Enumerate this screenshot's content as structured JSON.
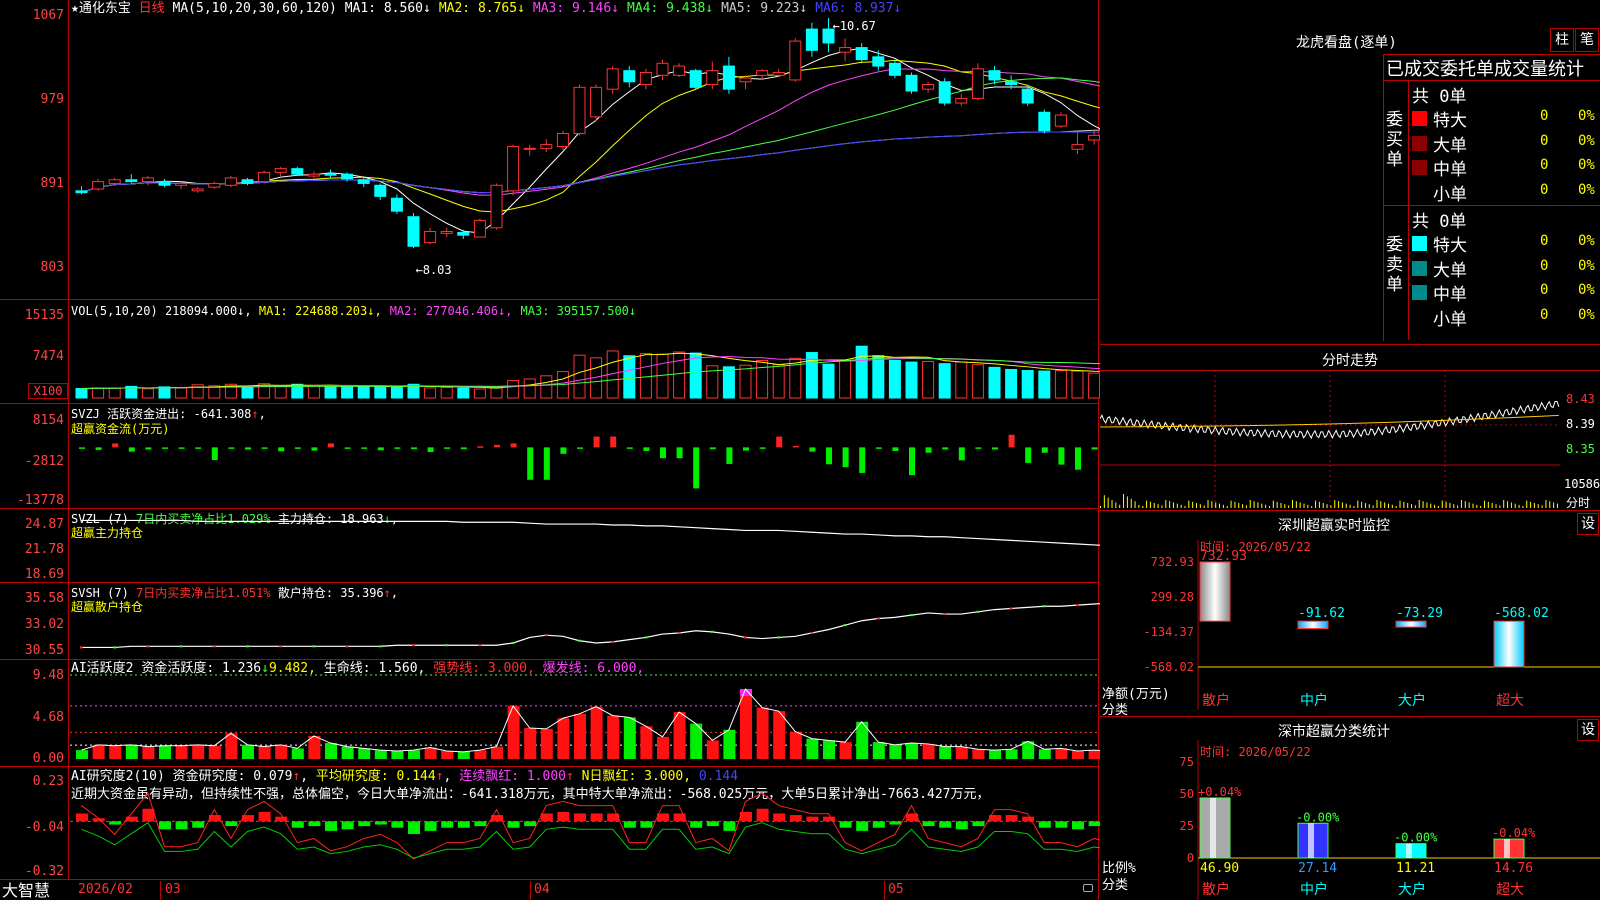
{
  "stock": {
    "star": "★",
    "name": "通化东宝",
    "period": "日线"
  },
  "ma_header": {
    "label": "MA(5,10,20,30,60,120)",
    "items": [
      {
        "text": "MA1: 8.560↓",
        "color": "#ffffff"
      },
      {
        "text": "MA2: 8.765↓",
        "color": "#ffff00"
      },
      {
        "text": "MA3: 9.146↓",
        "color": "#ff44ff"
      },
      {
        "text": "MA4: 9.438↓",
        "color": "#44ff44"
      },
      {
        "text": "MA5: 9.223↓",
        "color": "#cccccc"
      },
      {
        "text": "MA6: 8.937↓",
        "color": "#4444ff"
      }
    ],
    "high_mark": "10.67",
    "low_mark": "8.03"
  },
  "vol_header": {
    "label": "VOL(5,10,20)",
    "value": "218094.000↓,",
    "items": [
      {
        "text": "MA1: 224688.203↓,",
        "color": "#ffff00"
      },
      {
        "text": "MA2: 277046.406↓,",
        "color": "#ff44ff"
      },
      {
        "text": "MA3: 395157.500↓",
        "color": "#44ff44"
      }
    ]
  },
  "svzj_header": {
    "label": "SVZJ",
    "title": "活跃资金进出: -641.308",
    "arrow": "↑",
    "tail": ",",
    "sub": "超赢资金流(万元)"
  },
  "svzl_header": {
    "label": "SVZL (7)",
    "pct": "7日内买卖净占比1.029%",
    "title": "主力持仓: 18.963",
    "arrow": "↓",
    "tail": ",",
    "sub": "超赢主力持仓"
  },
  "svsh_header": {
    "label": "SVSH (7)",
    "pct": "7日内买卖净占比1.051%",
    "title": "散户持仓: 35.396",
    "arrow": "↑",
    "tail": ",",
    "sub": "超赢散户持仓"
  },
  "ai1_header": {
    "label": "AI活跃度2",
    "t1": "资金活跃度: 1.236",
    "a1": "↓",
    "t2": "9.482,",
    "t3": "生命线: 1.560,",
    "t4": "强势线: 3.000,",
    "t5": "爆发线: 6.000,"
  },
  "ai2_header": {
    "label": "AI研究度2(10)",
    "t1": "资金研究度: 0.079",
    "a1": "↑",
    "t2": "平均研究度: 0.144",
    "a2": "↑",
    "t3": "连续飘红: 1.000",
    "a3": "↑",
    "t4": "N日飘红: 3.000,",
    "t5": "0.144",
    "comment": "近期大资金虽有异动，但持续性不强，总体偏空，今日大单净流出：-641.318万元，其中特大单净流出：-568.025万元，大单5日累计净出-7663.427万元，"
  },
  "axes": {
    "price": [
      "1067",
      "979",
      "891",
      "803"
    ],
    "vol": [
      "15135",
      "7474",
      "X100"
    ],
    "svzj": [
      "8154",
      "-2812",
      "-13778"
    ],
    "svzl": [
      "24.87",
      "21.78",
      "18.69"
    ],
    "svsh": [
      "35.58",
      "33.02",
      "30.55"
    ],
    "ai1": [
      "9.48",
      "4.68",
      "0.00"
    ],
    "ai2": [
      "0.23",
      "-0.04",
      "-0.32"
    ]
  },
  "bottom_bar": {
    "logo": "大智慧",
    "dates": [
      "2026/02",
      "03",
      "04",
      "05"
    ]
  },
  "right": {
    "dragon_title": "龙虎看盘(逐单)",
    "btn_zhu": "柱",
    "btn_bi": "笔",
    "stat_title": "已成交委托单成交量统计",
    "buy_label": "委买单",
    "sell_label": "委卖单",
    "buy_total": "共 0单",
    "sell_total": "共 0单",
    "rows": [
      {
        "name": "特大",
        "v": "0",
        "p": "0%"
      },
      {
        "name": "大单",
        "v": "0",
        "p": "0%"
      },
      {
        "name": "中单",
        "v": "0",
        "p": "0%"
      },
      {
        "name": "小单",
        "v": "0",
        "p": "0%"
      }
    ],
    "fenshi_title": "分时走势",
    "fenshi_axis": [
      "8.43",
      "8.39",
      "8.35"
    ],
    "fenshi_vol": "10586",
    "fenshi_vol_label": "分时",
    "monitor_title": "深圳超赢实时监控",
    "monitor_btn": "设",
    "monitor_time": "时间: 2026/05/22",
    "monitor_axis": [
      "732.93",
      "299.28",
      "-134.37",
      "-568.02"
    ],
    "monitor_unit": "净额(万元)",
    "monitor_cat_label": "分类",
    "monitor_values": [
      "732.93",
      "-91.62",
      "-73.29",
      "-568.02"
    ],
    "categories": [
      "散户",
      "中户",
      "大户",
      "超大"
    ],
    "class_title": "深市超赢分类统计",
    "class_btn": "设",
    "class_time": "时间: 2026/05/22",
    "class_axis": [
      "75",
      "50",
      "25",
      "0"
    ],
    "class_unit": "比例%",
    "class_cat_label": "分类",
    "class_pct": [
      "+0.04%",
      "-0.00%",
      "-0.00%",
      "-0.04%"
    ],
    "class_values": [
      "46.90",
      "27.14",
      "11.21",
      "14.76"
    ]
  },
  "chart_data": [
    {
      "type": "candlestick",
      "title": "通化东宝 日线",
      "ylim": [
        8.03,
        10.67
      ],
      "ohlc": [
        [
          8.8,
          8.85,
          8.76,
          8.78
        ],
        [
          8.82,
          8.93,
          8.8,
          8.9
        ],
        [
          8.88,
          8.94,
          8.86,
          8.92
        ],
        [
          8.92,
          8.98,
          8.88,
          8.9
        ],
        [
          8.9,
          8.96,
          8.86,
          8.94
        ],
        [
          8.9,
          8.93,
          8.84,
          8.86
        ],
        [
          8.86,
          8.9,
          8.82,
          8.88
        ],
        [
          8.8,
          8.84,
          8.78,
          8.82
        ],
        [
          8.84,
          8.9,
          8.82,
          8.88
        ],
        [
          8.86,
          8.96,
          8.84,
          8.94
        ],
        [
          8.92,
          8.94,
          8.86,
          8.88
        ],
        [
          8.9,
          9.02,
          8.88,
          9.0
        ],
        [
          9.0,
          9.06,
          8.96,
          9.04
        ],
        [
          9.04,
          9.06,
          8.96,
          8.98
        ],
        [
          8.96,
          9.01,
          8.93,
          8.98
        ],
        [
          8.98,
          9.03,
          8.94,
          8.97
        ],
        [
          8.98,
          9.0,
          8.9,
          8.93
        ],
        [
          8.92,
          8.96,
          8.84,
          8.88
        ],
        [
          8.86,
          8.88,
          8.7,
          8.74
        ],
        [
          8.72,
          8.76,
          8.55,
          8.58
        ],
        [
          8.52,
          8.56,
          8.18,
          8.2
        ],
        [
          8.24,
          8.4,
          8.22,
          8.36
        ],
        [
          8.34,
          8.4,
          8.3,
          8.36
        ],
        [
          8.35,
          8.38,
          8.28,
          8.32
        ],
        [
          8.3,
          8.5,
          8.3,
          8.48
        ],
        [
          8.4,
          8.88,
          8.38,
          8.86
        ],
        [
          8.8,
          9.3,
          8.75,
          9.28
        ],
        [
          9.25,
          9.3,
          9.18,
          9.26
        ],
        [
          9.26,
          9.36,
          9.22,
          9.3
        ],
        [
          9.28,
          9.45,
          9.24,
          9.42
        ],
        [
          9.42,
          9.95,
          9.4,
          9.92
        ],
        [
          9.6,
          9.95,
          9.55,
          9.92
        ],
        [
          9.9,
          10.15,
          9.85,
          10.12
        ],
        [
          10.1,
          10.15,
          9.92,
          9.98
        ],
        [
          9.95,
          10.12,
          9.9,
          10.08
        ],
        [
          10.05,
          10.22,
          10.0,
          10.18
        ],
        [
          10.05,
          10.18,
          10.03,
          10.15
        ],
        [
          10.1,
          10.12,
          9.9,
          9.92
        ],
        [
          9.95,
          10.2,
          9.9,
          10.1
        ],
        [
          10.15,
          10.25,
          9.85,
          9.9
        ],
        [
          9.98,
          10.05,
          9.9,
          10.02
        ],
        [
          10.05,
          10.12,
          10.0,
          10.1
        ],
        [
          10.05,
          10.12,
          10.03,
          10.08
        ],
        [
          10.0,
          10.45,
          9.98,
          10.42
        ],
        [
          10.55,
          10.62,
          10.25,
          10.32
        ],
        [
          10.55,
          10.67,
          10.3,
          10.4
        ],
        [
          10.3,
          10.45,
          10.2,
          10.35
        ],
        [
          10.35,
          10.4,
          10.18,
          10.22
        ],
        [
          10.25,
          10.32,
          10.1,
          10.15
        ],
        [
          10.18,
          10.22,
          10.02,
          10.05
        ],
        [
          10.05,
          10.08,
          9.85,
          9.88
        ],
        [
          9.9,
          9.98,
          9.86,
          9.95
        ],
        [
          9.98,
          10.02,
          9.72,
          9.75
        ],
        [
          9.75,
          9.85,
          9.72,
          9.8
        ],
        [
          9.8,
          10.18,
          9.78,
          10.12
        ],
        [
          10.1,
          10.15,
          9.95,
          10.0
        ],
        [
          9.98,
          10.05,
          9.9,
          9.95
        ],
        [
          9.9,
          9.95,
          9.72,
          9.75
        ],
        [
          9.65,
          9.68,
          9.42,
          9.45
        ],
        [
          9.5,
          9.65,
          9.48,
          9.62
        ],
        [
          9.25,
          9.45,
          9.2,
          9.3
        ],
        [
          9.35,
          9.45,
          9.3,
          9.4
        ],
        [
          9.32,
          9.38,
          9.25,
          9.3
        ],
        [
          9.28,
          9.32,
          9.14,
          9.18
        ],
        [
          9.15,
          9.22,
          9.1,
          9.2
        ],
        [
          9.1,
          9.22,
          9.05,
          9.12
        ],
        [
          9.05,
          9.12,
          8.98,
          9.02
        ],
        [
          9.0,
          9.05,
          8.98,
          9.02
        ],
        [
          8.98,
          9.02,
          8.85,
          8.88
        ],
        [
          8.86,
          8.88,
          8.76,
          8.78
        ],
        [
          8.78,
          8.8,
          8.66,
          8.68
        ],
        [
          8.65,
          8.72,
          8.62,
          8.7
        ],
        [
          8.68,
          8.72,
          8.55,
          8.58
        ],
        [
          8.56,
          8.58,
          8.48,
          8.52
        ],
        [
          8.52,
          8.56,
          8.36,
          8.38
        ],
        [
          8.4,
          8.45,
          8.38,
          8.42
        ]
      ]
    },
    {
      "type": "bar",
      "title": "VOL(5,10,20)",
      "ylim": [
        0,
        15135
      ],
      "values": [
        1800,
        1900,
        1850,
        2200,
        1750,
        2100,
        1900,
        2500,
        2300,
        2600,
        2100,
        2700,
        2200,
        2600,
        2400,
        2300,
        2200,
        2100,
        2300,
        2000,
        2600,
        1900,
        2000,
        1850,
        1700,
        1900,
        3300,
        3600,
        4200,
        5000,
        8100,
        7600,
        8900,
        8000,
        8400,
        8300,
        8700,
        8500,
        6100,
        5900,
        6200,
        7100,
        6300,
        7500,
        8600,
        6400,
        7100,
        9800,
        8000,
        7100,
        6800,
        6900,
        6500,
        6800,
        6300,
        5800,
        5400,
        5200,
        5100,
        5200,
        5100,
        4700,
        4900,
        3700,
        3500,
        3400,
        3500,
        3000,
        3400,
        3000,
        3300,
        3000,
        2600,
        2500,
        2700,
        2400
      ]
    },
    {
      "type": "bar",
      "title": "超赢资金流(万元)",
      "ylim": [
        -13778,
        8154
      ],
      "values": [
        -400,
        -700,
        1100,
        -1200,
        -600,
        -300,
        -300,
        -300,
        -3500,
        -200,
        -600,
        -200,
        -1100,
        -300,
        -900,
        1100,
        -200,
        -200,
        -800,
        -400,
        -500,
        -1300,
        -300,
        -500,
        300,
        700,
        1100,
        -9000,
        -9000,
        -1800,
        -400,
        3000,
        3000,
        -400,
        -1000,
        -3000,
        -3000,
        -11400,
        -500,
        -4600,
        -900,
        -200,
        3000,
        400,
        -1200,
        -4700,
        -5500,
        -7100,
        -300,
        -1000,
        -7700,
        -1500,
        -600,
        -3600,
        -300,
        -600,
        3500,
        -4300,
        -1500,
        -4800,
        -6200,
        -600,
        -300,
        -600,
        -700,
        -700,
        -500,
        -200,
        -1000,
        -700,
        -1200,
        -200,
        -600,
        -3600,
        -1000,
        -700
      ]
    },
    {
      "type": "line",
      "title": "超赢主力持仓",
      "ylim": [
        18.69,
        24.87
      ],
      "values": [
        24.6,
        24.6,
        24.6,
        24.6,
        24.6,
        24.6,
        24.6,
        24.5,
        24.5,
        24.5,
        24.5,
        24.5,
        24.5,
        24.5,
        24.5,
        24.5,
        24.5,
        24.5,
        24.5,
        24.5,
        24.5,
        24.5,
        24.5,
        24.4,
        24.4,
        24.4,
        24.4,
        24.3,
        24.2,
        24.2,
        24.2,
        24.2,
        24.1,
        24.1,
        24.0,
        24.0,
        23.9,
        23.8,
        23.7,
        23.6,
        23.5,
        23.5,
        23.5,
        23.4,
        23.3,
        23.2,
        23.1,
        23.1,
        23.0,
        22.9,
        22.9,
        22.8,
        22.8,
        22.7,
        22.6,
        22.5,
        22.4,
        22.3,
        22.2,
        22.1,
        22.0,
        21.9,
        21.8,
        21.7,
        21.6,
        21.5,
        21.3,
        21.2,
        21.0,
        20.8,
        20.6,
        20.4,
        20.2,
        19.9,
        19.4,
        19.1
      ]
    },
    {
      "type": "line",
      "title": "超赢散户持仓",
      "ylim": [
        30.55,
        35.58
      ],
      "values": [
        30.6,
        30.6,
        30.6,
        30.7,
        30.7,
        30.7,
        30.7,
        30.7,
        30.7,
        30.7,
        30.7,
        30.7,
        30.7,
        30.7,
        30.7,
        30.7,
        30.7,
        30.7,
        30.7,
        30.8,
        30.8,
        30.8,
        30.8,
        30.8,
        30.8,
        30.8,
        31.0,
        31.5,
        31.7,
        31.6,
        31.2,
        31.0,
        31.1,
        31.3,
        31.5,
        31.8,
        31.9,
        32.1,
        32.0,
        31.8,
        31.5,
        31.4,
        31.5,
        31.6,
        31.9,
        32.2,
        32.6,
        33.0,
        33.2,
        33.3,
        33.5,
        33.7,
        33.6,
        33.6,
        33.8,
        34.0,
        34.1,
        34.2,
        34.3,
        34.3,
        34.4,
        34.5,
        34.6,
        34.7,
        34.8,
        34.9,
        35.0,
        35.1,
        35.1,
        35.2,
        35.2,
        35.2,
        35.3,
        35.3,
        35.4,
        35.4
      ]
    },
    {
      "type": "bar",
      "title": "AI活跃度2",
      "ylim": [
        0,
        9.48
      ],
      "values": [
        1.0,
        1.6,
        1.5,
        1.6,
        1.4,
        1.5,
        1.5,
        1.6,
        1.5,
        2.9,
        1.6,
        1.4,
        1.6,
        1.2,
        2.6,
        1.8,
        1.4,
        1.2,
        1.0,
        0.9,
        1.0,
        1.3,
        0.9,
        0.8,
        1.0,
        1.4,
        6.0,
        3.5,
        3.4,
        4.6,
        5.1,
        5.9,
        4.9,
        4.7,
        3.7,
        2.5,
        5.3,
        4.0,
        2.1,
        3.3,
        7.9,
        5.8,
        5.4,
        3.1,
        2.3,
        2.1,
        1.9,
        4.2,
        1.9,
        1.6,
        1.8,
        1.7,
        1.4,
        1.4,
        1.1,
        1.0,
        1.1,
        2.0,
        1.1,
        1.2,
        0.9,
        1.0,
        0.9,
        0.8,
        1.0,
        0.9,
        0.8,
        0.9,
        0.8,
        0.8,
        0.7,
        0.8,
        0.7,
        0.9,
        0.8,
        1.2
      ]
    },
    {
      "type": "bar",
      "title": "AI研究度2(10)",
      "ylim": [
        -0.32,
        0.23
      ],
      "values": [
        0.05,
        0.02,
        -0.02,
        0.03,
        0.08,
        -0.05,
        -0.05,
        -0.04,
        0.04,
        -0.03,
        0.04,
        0.06,
        0.03,
        -0.04,
        -0.03,
        -0.06,
        -0.05,
        -0.03,
        -0.02,
        -0.04,
        -0.08,
        -0.06,
        -0.04,
        -0.04,
        -0.03,
        0.04,
        -0.04,
        -0.03,
        0.05,
        0.06,
        0.05,
        0.05,
        0.05,
        -0.04,
        -0.04,
        0.05,
        0.05,
        -0.04,
        -0.03,
        -0.06,
        0.06,
        0.08,
        0.05,
        0.04,
        0.03,
        0.03,
        -0.04,
        -0.06,
        -0.04,
        -0.02,
        0.05,
        -0.03,
        -0.04,
        -0.05,
        -0.03,
        0.04,
        0.04,
        0.03,
        -0.04,
        -0.04,
        -0.05,
        -0.03,
        -0.04,
        -0.03,
        -0.02,
        -0.03,
        -0.02,
        -0.04,
        -0.03,
        -0.02,
        -0.02,
        -0.03,
        0.04,
        0.03,
        -0.02,
        0.07
      ]
    },
    {
      "type": "bar",
      "title": "深圳超赢实时监控",
      "categories": [
        "散户",
        "中户",
        "大户",
        "超大"
      ],
      "values": [
        732.93,
        -91.62,
        -73.29,
        -568.02
      ],
      "ylabel": "净额(万元)",
      "ylim": [
        -568.02,
        732.93
      ]
    },
    {
      "type": "bar",
      "title": "深市超赢分类统计",
      "categories": [
        "散户",
        "中户",
        "大户",
        "超大"
      ],
      "values": [
        46.9,
        27.14,
        11.21,
        14.76
      ],
      "ylabel": "比例%",
      "ylim": [
        0,
        75
      ]
    }
  ]
}
